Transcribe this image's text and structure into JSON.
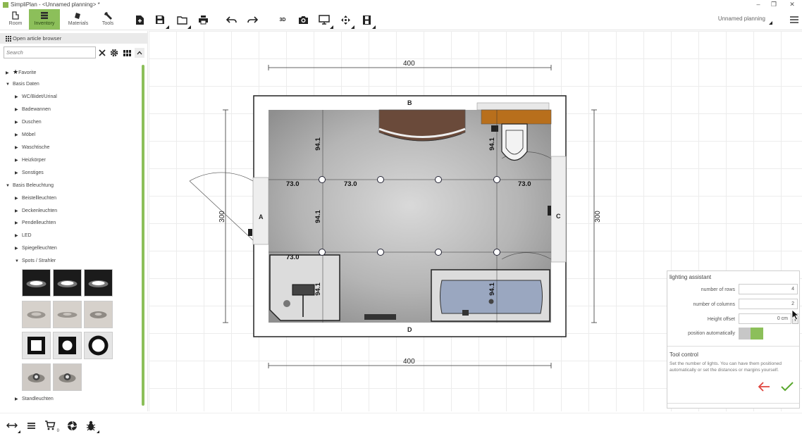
{
  "window": {
    "title": "SimpliPlan - <Unnamed planning> *",
    "minimize": "–",
    "maximize": "❐",
    "close": "✕"
  },
  "toolbar": {
    "modes": [
      {
        "label": "Room",
        "icon": "room-icon"
      },
      {
        "label": "Inventory",
        "icon": "inventory-icon",
        "active": true
      },
      {
        "label": "Materials",
        "icon": "materials-icon"
      },
      {
        "label": "Tools",
        "icon": "tools-icon"
      }
    ],
    "view_3d_label": "3D",
    "plan_name": "Unnamed planning",
    "menu_icon": "hamburger-menu-icon"
  },
  "sidebar": {
    "article_browser_label": "Open article browser",
    "search_placeholder": "Search",
    "tree": [
      {
        "label": "Favorite",
        "level": 0,
        "expanded": false,
        "star": true
      },
      {
        "label": "Basis Daten",
        "level": 0,
        "expanded": true
      },
      {
        "label": "WC/Bidet/Urinal",
        "level": 1,
        "expanded": false
      },
      {
        "label": "Badewannen",
        "level": 1,
        "expanded": false
      },
      {
        "label": "Duschen",
        "level": 1,
        "expanded": false
      },
      {
        "label": "Möbel",
        "level": 1,
        "expanded": false
      },
      {
        "label": "Waschtische",
        "level": 1,
        "expanded": false
      },
      {
        "label": "Heizkörper",
        "level": 1,
        "expanded": false
      },
      {
        "label": "Sonstiges",
        "level": 1,
        "expanded": false
      },
      {
        "label": "Basis Beleuchtung",
        "level": 0,
        "expanded": true
      },
      {
        "label": "Beistellleuchten",
        "level": 1,
        "expanded": false
      },
      {
        "label": "Deckenleuchten",
        "level": 1,
        "expanded": false
      },
      {
        "label": "Pendelleuchten",
        "level": 1,
        "expanded": false
      },
      {
        "label": "LED",
        "level": 1,
        "expanded": false
      },
      {
        "label": "Spiegelleuchten",
        "level": 1,
        "expanded": false
      },
      {
        "label": "Spots / Strahler",
        "level": 1,
        "expanded": true
      }
    ],
    "last_item": "Standleuchten"
  },
  "plan": {
    "dim_top": "400",
    "dim_bottom": "400",
    "dim_left": "300",
    "dim_right": "300",
    "wall_a": "A",
    "wall_b": "B",
    "wall_c": "C",
    "wall_d": "D",
    "spacing_73_1": "73.0",
    "spacing_73_2": "73.0",
    "spacing_73_3": "73.0",
    "spacing_73_4": "73.0",
    "spacing_94_1": "94.1",
    "spacing_94_2": "94.1",
    "spacing_94_3": "94.1",
    "spacing_94_4": "94.1",
    "spacing_94_5": "94.1"
  },
  "assistant": {
    "title": "lighting assistant",
    "rows_label": "number of rows",
    "rows_value": "4",
    "columns_label": "number of columns",
    "columns_value": "2",
    "height_label": "Height offset",
    "height_value": "0 cm",
    "auto_label": "position automatically",
    "auto_on": true,
    "tool_control_title": "Tool control",
    "tool_control_text": "Set the number of lights. You can have them positioned automatically or set the distances or margins yourself.",
    "colors": {
      "back": "#e0463f",
      "confirm": "#5aa82e",
      "accent": "#8cbf5a"
    }
  },
  "bottombar": {
    "icons": [
      "arrows-horizontal-icon",
      "list-icon",
      "cart-icon",
      "aperture-icon",
      "bug-icon"
    ],
    "cart_count": "0"
  }
}
